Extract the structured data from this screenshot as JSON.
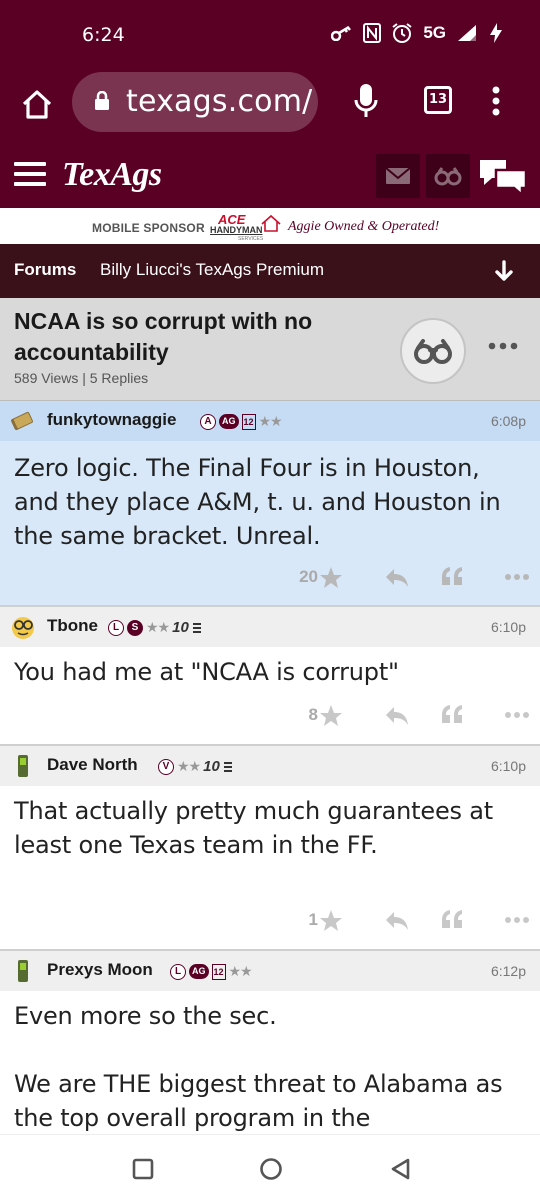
{
  "status_bar": {
    "time": "6:24",
    "network": "5G"
  },
  "browser": {
    "url": "texags.com/",
    "tab_count": "13"
  },
  "site": {
    "logo": "TexAgs"
  },
  "sponsor": {
    "label": "MOBILE SPONSOR",
    "brand_top": "ACE",
    "brand_main": "HANDYMAN",
    "brand_sub": "SERVICES",
    "tagline": "Aggie Owned & Operated!"
  },
  "forum_nav": {
    "forums_label": "Forums",
    "board_name": "Billy Liucci's TexAgs Premium"
  },
  "thread": {
    "title": "NCAA is so corrupt with no accountability",
    "meta": "589 Views | 5 Replies"
  },
  "posts": [
    {
      "user": "funkytownaggie",
      "badges": [
        "A",
        "AG",
        "12",
        "★★"
      ],
      "time": "6:08p",
      "body": "Zero logic. The Final Four is in Houston, and they place A&M, t. u. and Houston in the same bracket. Unreal.",
      "stars": "20"
    },
    {
      "user": "Tbone",
      "badges": [
        "L",
        "S",
        "★★",
        "10"
      ],
      "time": "6:10p",
      "body": "You had me at \"NCAA is corrupt\"",
      "stars": "8"
    },
    {
      "user": "Dave North",
      "badges": [
        "V",
        "★★",
        "10"
      ],
      "time": "6:10p",
      "body": "That actually pretty much guarantees at least one Texas team in the FF.",
      "stars": "1"
    },
    {
      "user": "Prexys Moon",
      "badges": [
        "L",
        "AG",
        "12",
        "★★"
      ],
      "time": "6:12p",
      "body_line1": "Even more so the sec.",
      "body_line2": "We are THE biggest threat to Alabama as the top overall program in the"
    }
  ],
  "colors": {
    "maroon": "#5a0025",
    "highlight_post": "#d8e8f8",
    "post_header": "#efefef"
  }
}
